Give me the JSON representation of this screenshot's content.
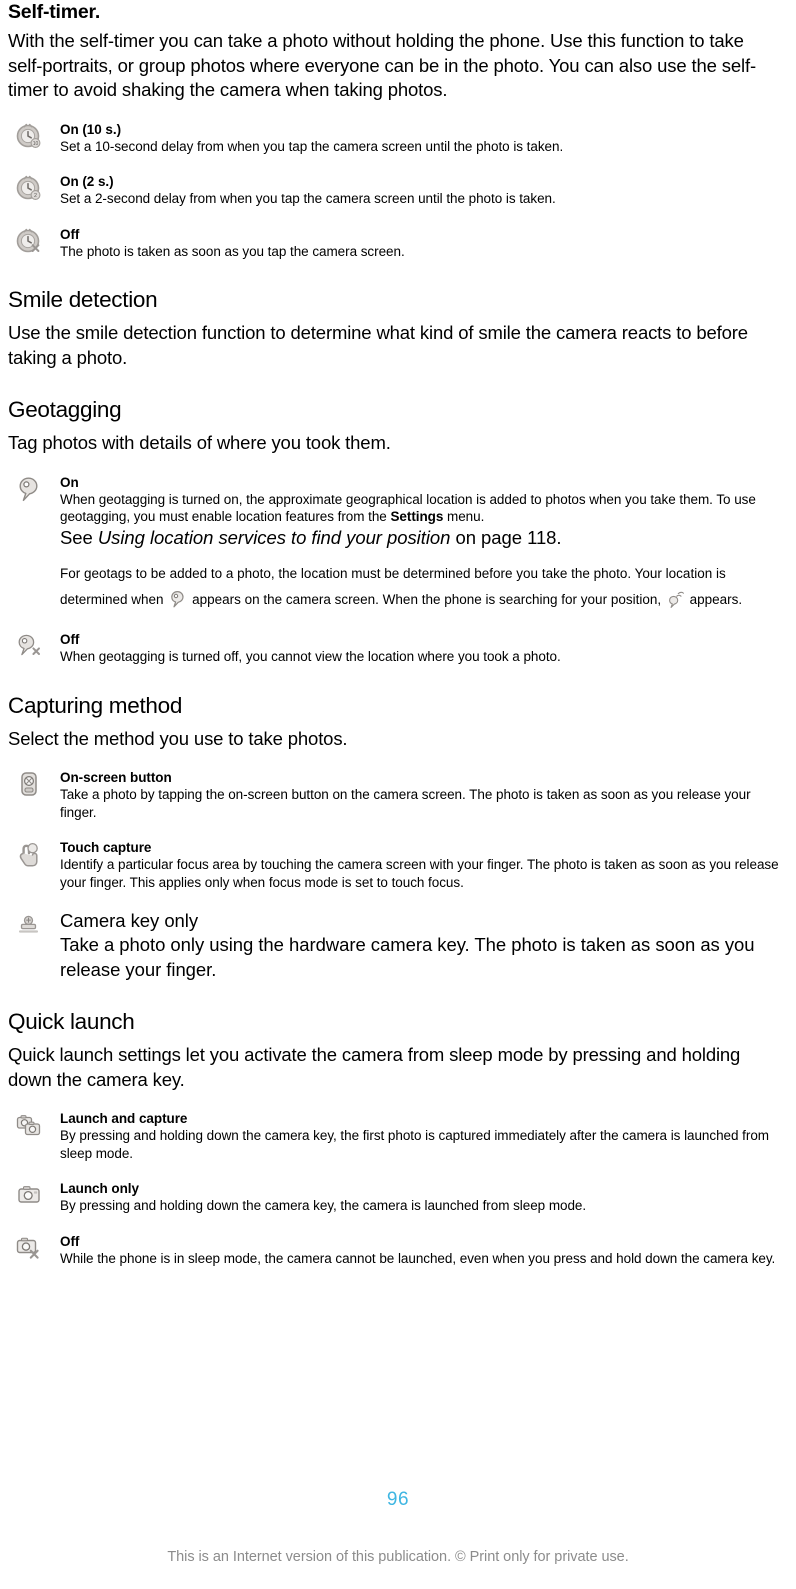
{
  "document": {
    "page_number": "96",
    "footer_note": "This is an Internet version of this publication. © Print only for private use."
  },
  "sections": [
    {
      "id": "self-timer",
      "heading": "Self-timer.",
      "heading_style": "bold",
      "intro": "With the self-timer you can take a photo without holding the phone. Use this function to take self-portraits, or group photos where everyone can be in the photo. You can also use the self-timer to avoid shaking the camera when taking photos.",
      "options": [
        {
          "icon": "self-timer-10s-icon",
          "title": "On (10 s.)",
          "desc": "Set a 10-second delay from when you tap the camera screen until the photo is taken."
        },
        {
          "icon": "self-timer-2s-icon",
          "title": "On (2 s.)",
          "desc": "Set a 2-second delay from when you tap the camera screen until the photo is taken."
        },
        {
          "icon": "self-timer-off-icon",
          "title": "Off",
          "desc": "The photo is taken as soon as you tap the camera screen."
        }
      ]
    },
    {
      "id": "smile-detection",
      "heading": "Smile detection",
      "heading_style": "section",
      "intro": "Use the smile detection function to determine what kind of smile the camera reacts to before taking a photo.",
      "options": []
    },
    {
      "id": "geotagging",
      "heading": "Geotagging",
      "heading_style": "section",
      "intro": "Tag photos with details of where you took them.",
      "options": [
        {
          "icon": "geotag-on-icon",
          "title": "On",
          "desc_parts": {
            "p1": "When geotagging is turned on, the approximate geographical location is added to photos when you take them. To use geotagging, you must enable location features from the ",
            "bold1": "Settings",
            "p2": " menu.",
            "line2_pre": "See ",
            "italic1": "Using location services to find your position",
            "line2_post": " on page 118."
          },
          "note": {
            "pre": "For geotags to be added to a photo, the location must be determined before you take the photo. Your location is determined when ",
            "icon1": "location-found-icon",
            "mid": " appears on the camera screen. When the phone is searching for your position, ",
            "icon2": "location-searching-icon",
            "post": " appears."
          }
        },
        {
          "icon": "geotag-off-icon",
          "title": "Off",
          "desc": "When geotagging is turned off, you cannot view the location where you took a photo."
        }
      ]
    },
    {
      "id": "capturing-method",
      "heading": "Capturing method",
      "heading_style": "section",
      "intro": "Select the method you use to take photos.",
      "options": [
        {
          "icon": "on-screen-button-icon",
          "title": "On-screen button",
          "desc": "Take a photo by tapping the on-screen button on the camera screen. The photo is taken as soon as you release your finger."
        },
        {
          "icon": "touch-capture-icon",
          "title": "Touch capture",
          "desc": "Identify a particular focus area by touching the camera screen with your finger. The photo is taken as soon as you release your finger. This applies only when focus mode is set to touch focus."
        },
        {
          "icon": "camera-key-icon",
          "title": "Camera key only",
          "desc": "Take a photo only using the hardware camera key. The photo is taken as soon as you release your finger.",
          "large": true
        }
      ]
    },
    {
      "id": "quick-launch",
      "heading": "Quick launch",
      "heading_style": "section",
      "intro": "Quick launch settings let you activate the camera from sleep mode by pressing and holding down the camera key.",
      "options": [
        {
          "icon": "launch-and-capture-icon",
          "title": "Launch and capture",
          "desc": "By pressing and holding down the camera key, the first photo is captured immediately after the camera is launched from sleep mode."
        },
        {
          "icon": "launch-only-icon",
          "title": "Launch only",
          "desc": "By pressing and holding down the camera key, the camera is launched from sleep mode."
        },
        {
          "icon": "quick-launch-off-icon",
          "title": "Off",
          "desc": "While the phone is in sleep mode, the camera cannot be launched, even when you press and hold down the camera key."
        }
      ]
    }
  ],
  "colors": {
    "page_number": "#3fb6e2",
    "footer_text": "#8c8c8c",
    "body_text": "#000000",
    "icon_gray": "#b8b4b0"
  }
}
